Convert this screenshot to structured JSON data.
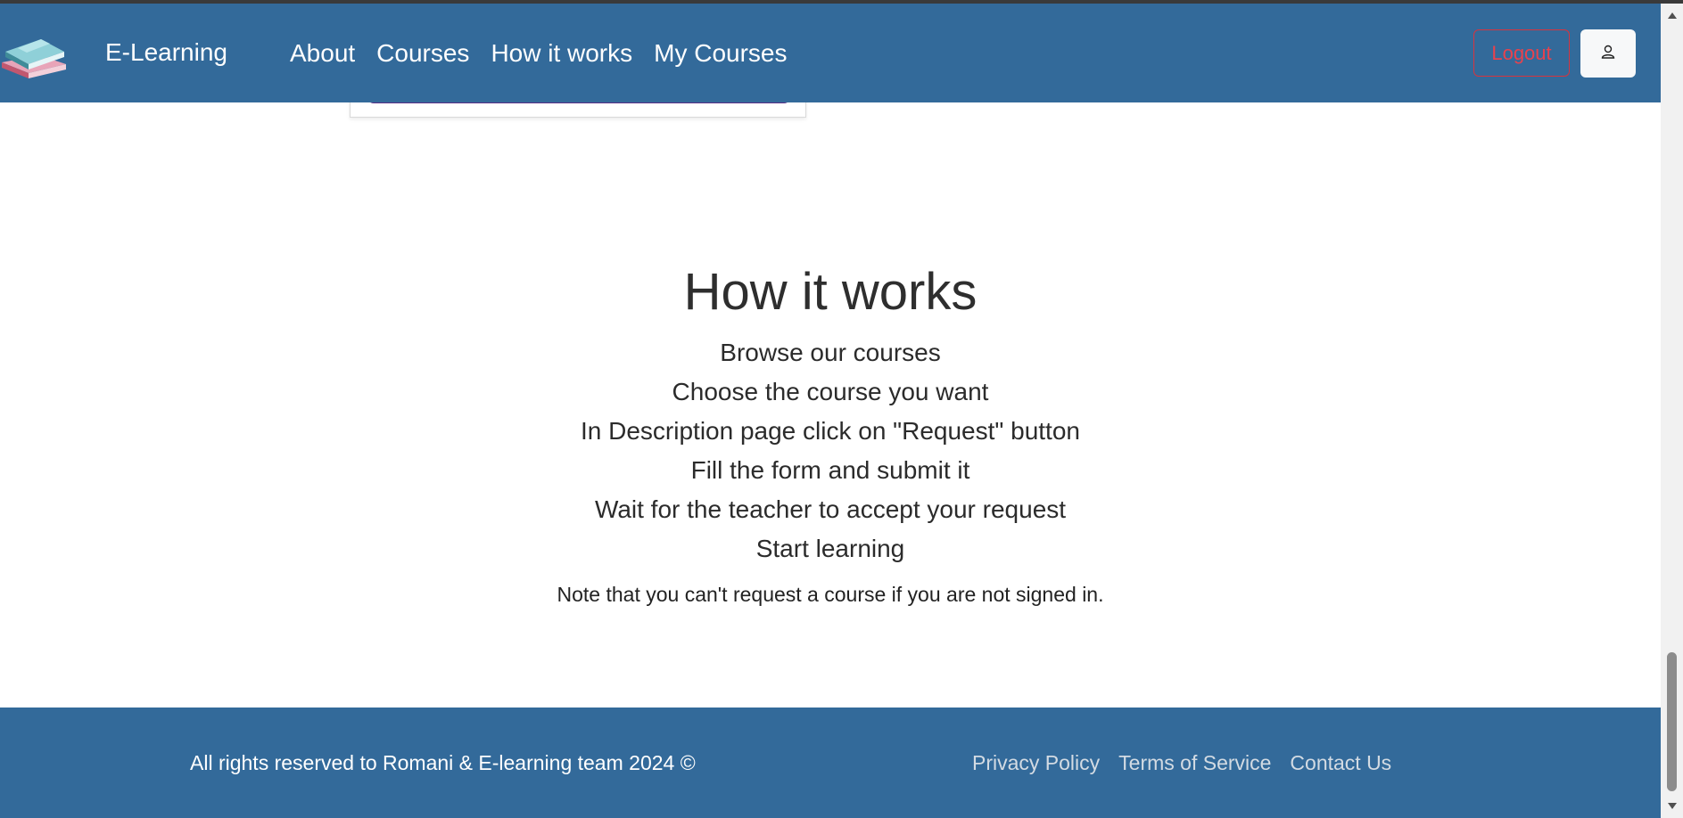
{
  "navbar": {
    "brand": "E-Learning",
    "links": [
      "About",
      "Courses",
      "How it works",
      "My Courses"
    ],
    "logout_label": "Logout"
  },
  "how_it_works": {
    "title": "How it works",
    "steps": [
      "Browse our courses",
      "Choose the course you want",
      "In Description page click on \"Request\" button",
      "Fill the form and submit it",
      "Wait for the teacher to accept your request",
      "Start learning"
    ],
    "note": "Note that you can't request a course if you are not signed in."
  },
  "footer": {
    "copyright": "All rights reserved to Romani & E-learning team 2024 ©",
    "links": [
      "Privacy Policy",
      "Terms of Service",
      "Contact Us"
    ]
  },
  "colors": {
    "primary": "#336a9a",
    "danger": "#e8424d",
    "card_button": "#5a2f86"
  },
  "icons": {
    "logo": "books-icon",
    "user": "user-icon"
  }
}
